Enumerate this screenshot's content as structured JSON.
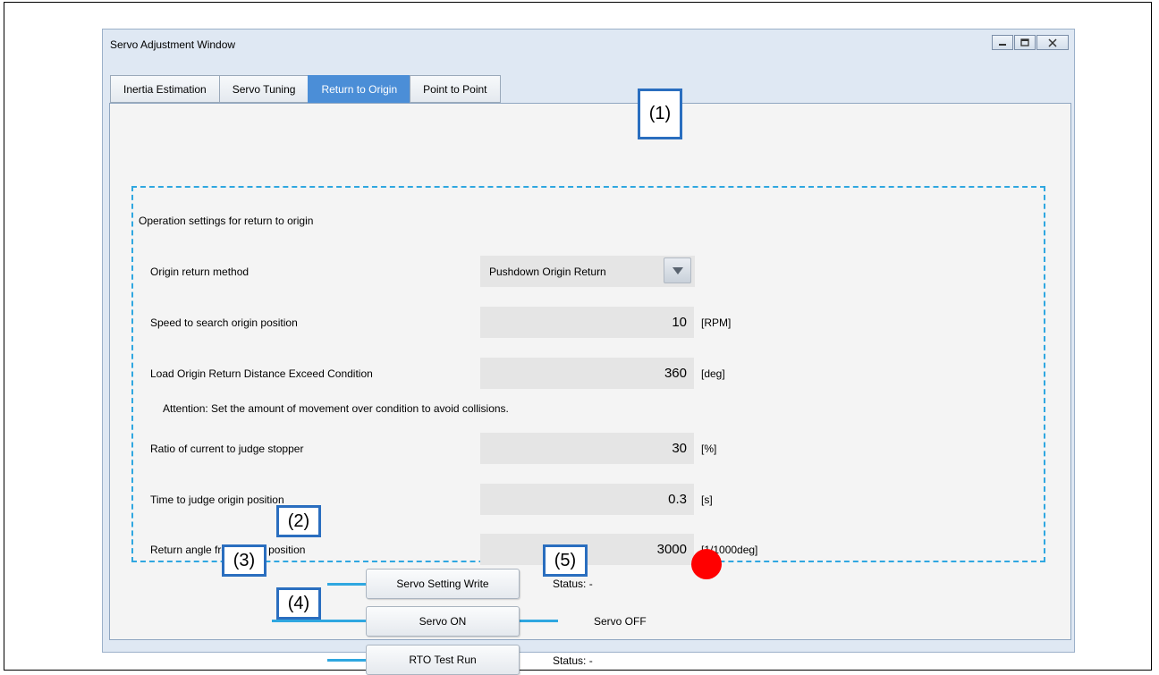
{
  "window": {
    "title": "Servo Adjustment Window"
  },
  "tabs": [
    {
      "label": "Inertia Estimation"
    },
    {
      "label": "Servo Tuning"
    },
    {
      "label": "Return to Origin"
    },
    {
      "label": "Point to Point"
    }
  ],
  "active_tab": "Return to Origin",
  "section_title": "Operation settings for return to origin",
  "origin_method": {
    "label": "Origin return method",
    "value": "Pushdown Origin Return"
  },
  "search_speed": {
    "label": "Speed to search origin position",
    "value": "10",
    "unit": "[RPM]"
  },
  "exceed_condition": {
    "label": "Load Origin Return Distance Exceed Condition",
    "value": "360",
    "unit": "[deg]"
  },
  "attention": "Attention: Set the amount of movement over condition to avoid collisions.",
  "current_ratio": {
    "label": "Ratio of current to judge stopper",
    "value": "30",
    "unit": "[%]"
  },
  "judge_time": {
    "label": "Time to judge origin position",
    "value": "0.3",
    "unit": "[s]"
  },
  "return_angle": {
    "label": "Return angle from origin position",
    "value": "3000",
    "unit": "[1/1000deg]"
  },
  "buttons": {
    "servo_setting_write": "Servo Setting Write",
    "servo_on": "Servo ON",
    "rto_test_run": "RTO Test Run"
  },
  "status": {
    "write_status": "Status:  -",
    "servo_state": "Servo OFF",
    "rto_status": "Status:  -"
  },
  "callouts": {
    "c1": "(1)",
    "c2": "(2)",
    "c3": "(3)",
    "c4": "(4)",
    "c5": "(5)"
  },
  "colors": {
    "led": "#ff0000",
    "callout_border": "#2a6ebf",
    "dashed_border": "#2fa7e0",
    "active_tab": "#4b8ed7"
  }
}
